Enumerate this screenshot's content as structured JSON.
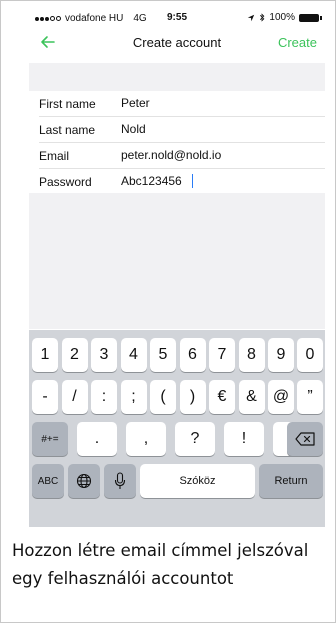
{
  "status_bar": {
    "carrier": "vodafone HU",
    "network": "4G",
    "time": "9:55",
    "battery": "100%"
  },
  "nav": {
    "title": "Create account",
    "action_label": "Create",
    "back_icon": "arrow-left-icon",
    "accent_color": "#3cc35b"
  },
  "form": {
    "fields": [
      {
        "label": "First name",
        "value": "Peter"
      },
      {
        "label": "Last name",
        "value": "Nold"
      },
      {
        "label": "Email",
        "value": "peter.nold@nold.io"
      },
      {
        "label": "Password",
        "value": "Abc123456"
      }
    ]
  },
  "keyboard": {
    "row1": [
      "1",
      "2",
      "3",
      "4",
      "5",
      "6",
      "7",
      "8",
      "9",
      "0"
    ],
    "row2": [
      "-",
      "/",
      ":",
      ";",
      "(",
      ")",
      "€",
      "&",
      "@",
      "”"
    ],
    "row3_mode": "#+=",
    "row3": [
      ".",
      ",",
      "?",
      "!",
      "’"
    ],
    "backspace_icon": "backspace-icon",
    "mode_label": "ABC",
    "globe_icon": "globe-icon",
    "mic_icon": "microphone-icon",
    "space_label": "Szóköz",
    "return_label": "Return"
  },
  "caption": "Hozzon létre email címmel jelszóval egy felhasználói accountot"
}
